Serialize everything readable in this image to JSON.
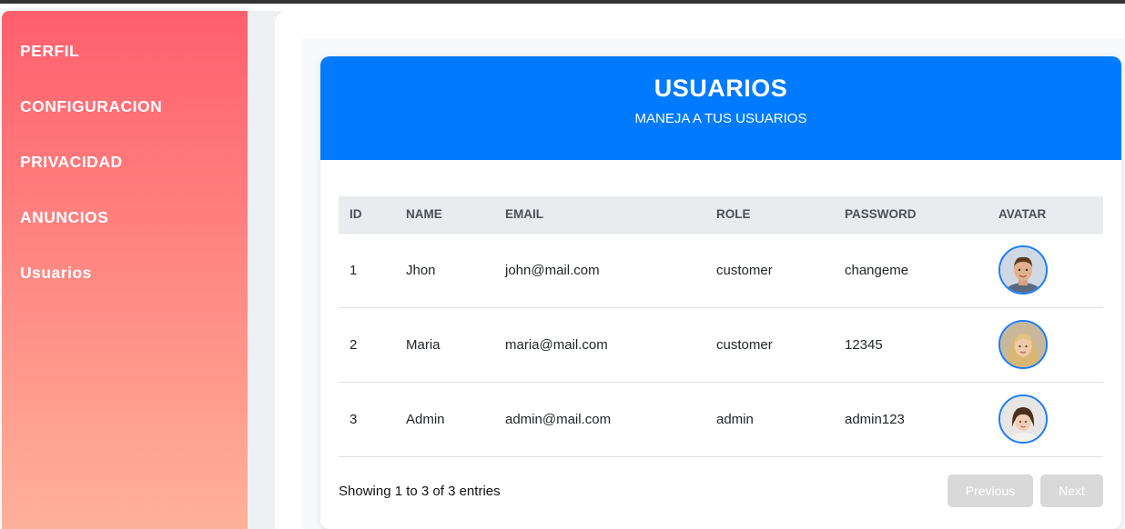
{
  "sidebar": {
    "items": [
      {
        "label": "PERFIL"
      },
      {
        "label": "CONFIGURACION"
      },
      {
        "label": "PRIVACIDAD"
      },
      {
        "label": "ANUNCIOS"
      },
      {
        "label": "Usuarios"
      }
    ]
  },
  "card": {
    "title": "USUARIOS",
    "subtitle": "MANEJA A TUS USUARIOS"
  },
  "table": {
    "headers": [
      "ID",
      "NAME",
      "EMAIL",
      "ROLE",
      "PASSWORD",
      "AVATAR"
    ],
    "rows": [
      {
        "id": "1",
        "name": "Jhon",
        "email": "john@mail.com",
        "role": "customer",
        "password": "changeme",
        "avatar": "avatar-man-photo"
      },
      {
        "id": "2",
        "name": "Maria",
        "email": "maria@mail.com",
        "role": "customer",
        "password": "12345",
        "avatar": "avatar-blonde-woman-photo"
      },
      {
        "id": "3",
        "name": "Admin",
        "email": "admin@mail.com",
        "role": "admin",
        "password": "admin123",
        "avatar": "avatar-girl-photo"
      }
    ]
  },
  "footer": {
    "showing": "Showing 1 to 3 of 3 entries",
    "previous_label": "Previous",
    "next_label": "Next"
  },
  "colors": {
    "header_blue": "#007bff",
    "sidebar_gradient_top": "#ff5f6d",
    "sidebar_gradient_bottom": "#ffb199",
    "avatar_border": "#1a7bff",
    "disabled_button": "#d9d9d9"
  }
}
